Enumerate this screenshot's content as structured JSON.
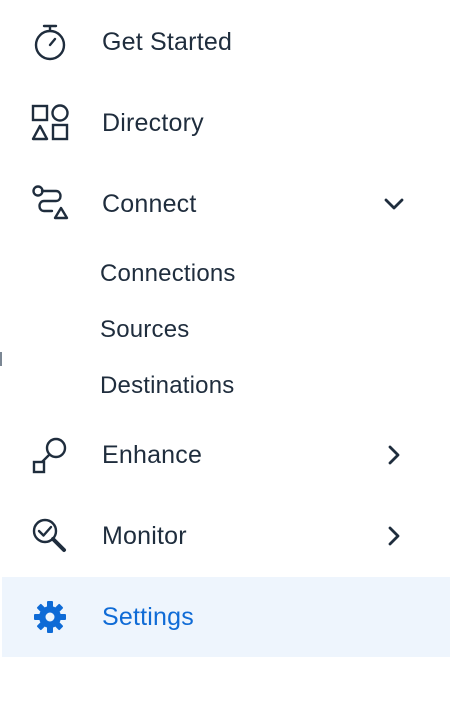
{
  "nav": {
    "get_started": {
      "label": "Get Started",
      "icon": "stopwatch-icon"
    },
    "directory": {
      "label": "Directory",
      "icon": "shapes-icon"
    },
    "connect": {
      "label": "Connect",
      "icon": "route-icon",
      "expanded": true,
      "children": [
        "Connections",
        "Sources",
        "Destinations"
      ]
    },
    "enhance": {
      "label": "Enhance",
      "icon": "node-connect-icon"
    },
    "monitor": {
      "label": "Monitor",
      "icon": "magnifier-check-icon"
    },
    "settings": {
      "label": "Settings",
      "icon": "gear-icon",
      "active": true
    }
  },
  "colors": {
    "text": "#1f2d3d",
    "accent": "#0f6bd6",
    "active_bg": "#eef5fd"
  }
}
